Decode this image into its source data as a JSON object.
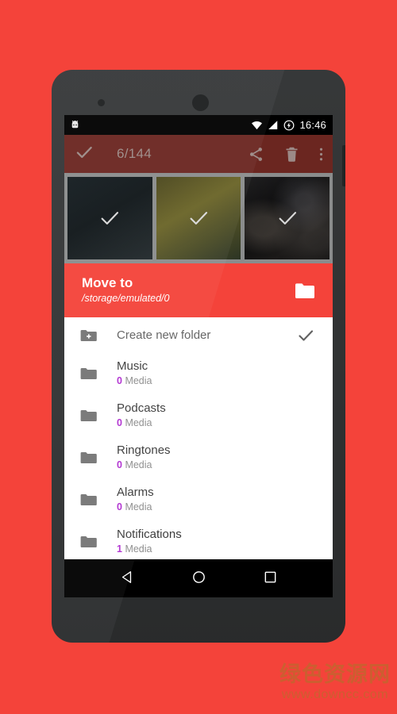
{
  "device": {
    "name": "android-phone-mockup",
    "frame_color": "#2f3132"
  },
  "statusbar": {
    "left_icon": "robot-head-icon",
    "icons": [
      "wifi-icon",
      "signal-icon",
      "charging-bolt-icon"
    ],
    "time": "16:46"
  },
  "toolbar": {
    "background": "#6b2620",
    "confirm_icon": "check-icon",
    "selection_count": "6/144",
    "actions": [
      {
        "name": "share-button",
        "icon": "share-icon"
      },
      {
        "name": "delete-button",
        "icon": "trash-icon"
      },
      {
        "name": "overflow-button",
        "icon": "more-vert-icon"
      }
    ]
  },
  "thumbnails": {
    "items": [
      {
        "name": "thumbnail-1",
        "selected": true,
        "style": "thumb-a"
      },
      {
        "name": "thumbnail-2",
        "selected": true,
        "style": "thumb-b"
      },
      {
        "name": "thumbnail-3",
        "selected": true,
        "style": "thumb-c"
      }
    ],
    "selected_icon": "check-icon"
  },
  "moveto": {
    "accent": "#f4433a",
    "title": "Move to",
    "path": "/storage/emulated/0",
    "action_icon": "folder-icon"
  },
  "list": {
    "create": {
      "icon": "folder-add-icon",
      "label": "Create new folder",
      "confirm_icon": "check-icon"
    },
    "count_color": "#b02fd0",
    "items": [
      {
        "icon": "folder-icon",
        "name": "Music",
        "count": "0",
        "unit": "Media"
      },
      {
        "icon": "folder-icon",
        "name": "Podcasts",
        "count": "0",
        "unit": "Media"
      },
      {
        "icon": "folder-icon",
        "name": "Ringtones",
        "count": "0",
        "unit": "Media"
      },
      {
        "icon": "folder-icon",
        "name": "Alarms",
        "count": "0",
        "unit": "Media"
      },
      {
        "icon": "folder-icon",
        "name": "Notifications",
        "count": "1",
        "unit": "Media"
      }
    ]
  },
  "navbar": {
    "buttons": [
      {
        "name": "nav-back-button",
        "icon": "triangle-back-icon"
      },
      {
        "name": "nav-home-button",
        "icon": "circle-home-icon"
      },
      {
        "name": "nav-recents-button",
        "icon": "square-recents-icon"
      }
    ]
  },
  "watermark": {
    "cn": "绿色资源网",
    "url": "www.downcc.com",
    "color": "#b5702a"
  }
}
